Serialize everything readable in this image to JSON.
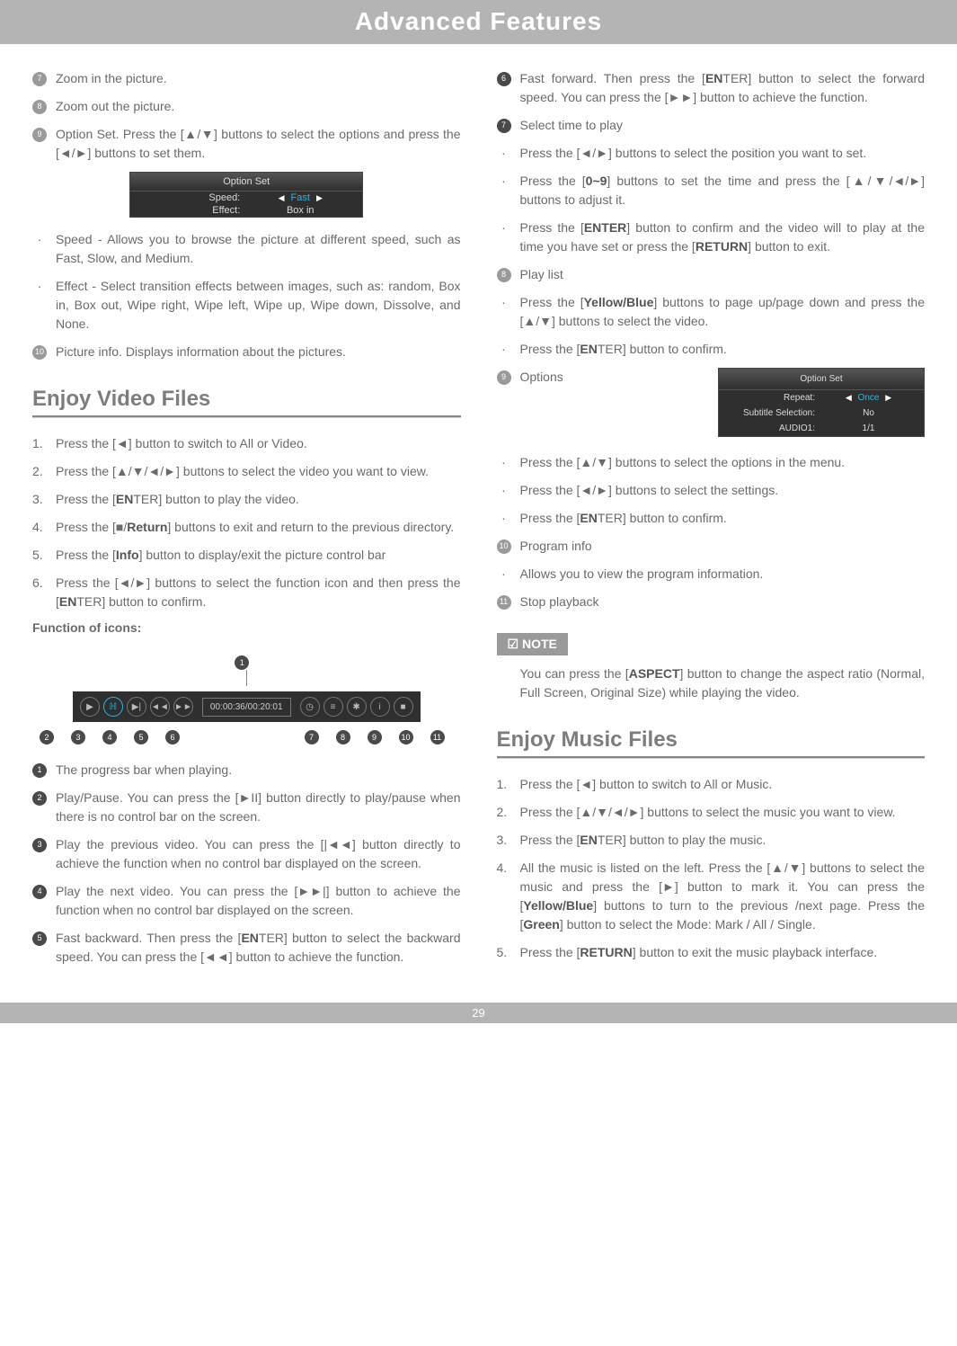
{
  "header": {
    "title": "Advanced Features"
  },
  "page_number": "29",
  "left": {
    "picture_items": [
      {
        "n": "7",
        "text": "Zoom in the picture."
      },
      {
        "n": "8",
        "text": "Zoom out the picture."
      },
      {
        "n": "9",
        "text": "Option Set. Press the [▲/▼] buttons to select the options and press the [◄/►] buttons to set them."
      }
    ],
    "option_set_picture": {
      "title": "Option Set",
      "rows": [
        {
          "label": "Speed:",
          "value": "Fast",
          "selected": true
        },
        {
          "label": "Effect:",
          "value": "Box in",
          "selected": false
        }
      ]
    },
    "picture_bullets": [
      "Speed - Allows you to browse the picture at different speed, such as Fast, Slow, and Medium.",
      "Effect - Select transition effects between images, such as: random, Box in, Box out, Wipe right, Wipe left, Wipe up, Wipe down, Dissolve, and None."
    ],
    "picture_item10": {
      "n": "10",
      "text": "Picture info. Displays information about the pictures."
    },
    "video_heading": "Enjoy Video Files",
    "video_steps": [
      "Press the [◄] button to switch to All or Video.",
      "Press the [▲/▼/◄/►] buttons to select the video you want to view.",
      "Press the [<b>EN</b>TER] button to play the video.",
      "Press the [■/<b>Return</b>] buttons to exit and return to the previous directory.",
      "Press the [<b>Info</b>] button to display/exit the picture control bar",
      "Press the [◄/►] buttons to select the function icon and then press the [<b>EN</b>TER] button to confirm."
    ],
    "func_label": "Function of icons:",
    "control_bar": {
      "time": "00:00:36/00:20:01",
      "top_n": "1",
      "left_nums": [
        "2",
        "3",
        "4",
        "5",
        "6"
      ],
      "right_nums": [
        "7",
        "8",
        "9",
        "10",
        "11"
      ]
    },
    "video_icons": [
      {
        "n": "1",
        "text": "The progress bar when playing."
      },
      {
        "n": "2",
        "text": "Play/Pause. You can press the [►II] button directly to play/pause when there is no control bar on the screen."
      },
      {
        "n": "3",
        "text": "Play the previous video. You can press the [|◄◄] button directly to achieve the function when no control bar displayed on the screen."
      },
      {
        "n": "4",
        "text": "Play the next video. You can press the [►►|] button to achieve the function when no control bar displayed on the screen."
      },
      {
        "n": "5",
        "text": "Fast backward. Then press the [<b>EN</b>TER] button to select the backward speed. You can press the [◄◄] button to achieve the function."
      }
    ]
  },
  "right": {
    "video_icons": [
      {
        "n": "6",
        "text": "Fast forward. Then press the [<b>EN</b>TER] button to select the forward speed. You can press the [►►] button to achieve the function."
      },
      {
        "n": "7",
        "text": "Select time to play"
      }
    ],
    "time_bullets": [
      "Press the [◄/►] buttons to select the position you want to set.",
      "Press the [<b>0~9</b>] buttons to set the time and press the [▲/▼/◄/►] buttons to adjust it.",
      "Press the [<b>ENTER</b>] button to confirm and the video will to play at the time you have set or press the [<b>RETURN</b>] button to exit."
    ],
    "item8": {
      "n": "8",
      "text": "Play list"
    },
    "playlist_bullets": [
      "Press the [<b>Yellow/Blue</b>] buttons to page up/page down and press the [▲/▼] buttons to select the video.",
      "Press the [<b>EN</b>TER] button to confirm."
    ],
    "item9": {
      "n": "9",
      "text": "Options"
    },
    "option_set_video": {
      "title": "Option Set",
      "rows": [
        {
          "label": "Repeat:",
          "value": "Once",
          "selected": true
        },
        {
          "label": "Subtitle Selection:",
          "value": "No",
          "selected": false
        },
        {
          "label": "AUDIO1:",
          "value": "1/1",
          "selected": false
        }
      ]
    },
    "options_bullets": [
      "Press the [▲/▼] buttons to select the options in the menu.",
      "Press the [◄/►] buttons to select the settings.",
      "Press the [<b>EN</b>TER] button to confirm."
    ],
    "item10": {
      "n": "10",
      "text": "Program info"
    },
    "program_bullet": "Allows you to view the program information.",
    "item11": {
      "n": "11",
      "text": "Stop playback"
    },
    "note_label": "NOTE",
    "note_text": "You can press the [<b>ASPECT</b>] button to change the aspect ratio (Normal, Full Screen, Original Size) while playing the video.",
    "music_heading": "Enjoy Music Files",
    "music_steps": [
      "Press the [◄] button to switch to All or Music.",
      "Press the [▲/▼/◄/►] buttons to select the music you want to view.",
      "Press the [<b>EN</b>TER] button to play the music.",
      "All the music is listed on the left. Press the [▲/▼] buttons to select the music and press the [►] button to mark it. You can press the [<b>Yellow/Blue</b>] buttons to turn to the previous /next page. Press the [<b>Green</b>] button to select the Mode: Mark / All / Single.",
      "Press the [<b>RETURN</b>] button to exit the music playback interface."
    ]
  }
}
